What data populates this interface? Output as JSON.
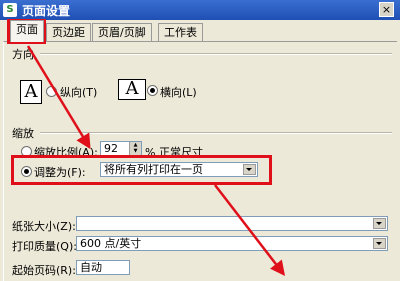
{
  "window": {
    "app_icon": "S",
    "title": "页面设置",
    "close": "×"
  },
  "tabs": [
    "页面",
    "页边距",
    "页眉/页脚",
    "工作表"
  ],
  "orientation": {
    "header": "方向",
    "portrait": "纵向(T)",
    "landscape": "横向(L)",
    "selected": "landscape",
    "page_icon_glyph": "A"
  },
  "scaling": {
    "header": "缩放",
    "scale_label": "缩放比例(A):",
    "scale_value": "92",
    "scale_suffix": "% 正常尺寸",
    "fit_label": "调整为(F):",
    "fit_value": "将所有列打印在一页",
    "selected": "fit"
  },
  "paper_size": {
    "label": "纸张大小(Z):",
    "value": ""
  },
  "print_quality": {
    "label": "打印质量(Q):",
    "value": "600 点/英寸"
  },
  "first_page": {
    "label": "起始页码(R):",
    "value": "自动"
  },
  "annotations": {
    "color": "#e0101a"
  }
}
